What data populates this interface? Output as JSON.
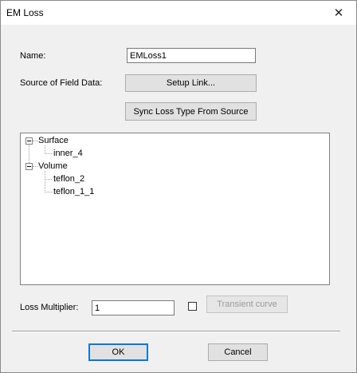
{
  "window": {
    "title": "EM Loss",
    "close_glyph": "✕"
  },
  "form": {
    "name_label": "Name:",
    "name_value": "EMLoss1",
    "source_label": "Source of Field Data:",
    "setup_link_label": "Setup Link...",
    "sync_label": "Sync Loss Type From Source",
    "loss_multiplier_label": "Loss Multiplier:",
    "loss_multiplier_value": "1",
    "transient_curve_label": "Transient curve"
  },
  "tree": {
    "groups": [
      {
        "label": "Surface",
        "children": [
          "inner_4"
        ]
      },
      {
        "label": "Volume",
        "children": [
          "teflon_2",
          "teflon_1_1"
        ]
      }
    ]
  },
  "footer": {
    "ok_label": "OK",
    "cancel_label": "Cancel"
  },
  "icons": {
    "close": "close-icon",
    "expander": "minus-expander-icon",
    "checkbox": "checkbox-icon"
  }
}
